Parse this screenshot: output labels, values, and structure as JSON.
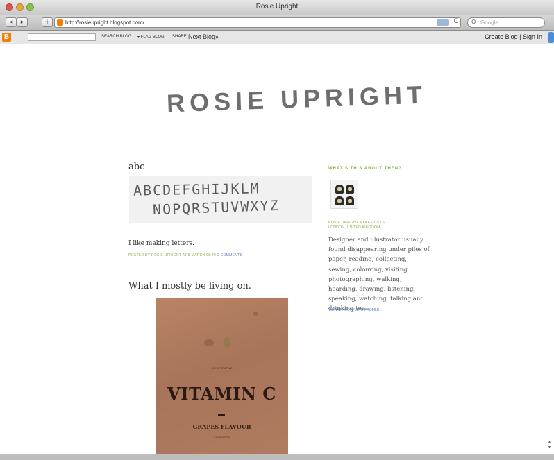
{
  "window": {
    "title": "Rosie Upright"
  },
  "browser": {
    "url": "http://rosieupright.blogspot.com/",
    "search_placeholder": "Google",
    "back_icon": "◂",
    "forward_icon": "▸",
    "add_icon": "+",
    "reload_icon": "C",
    "search_icon": "Q"
  },
  "blogger_bar": {
    "logo": "B",
    "search_label": "SEARCH BLOG",
    "flag_label": "▾ FLAG BLOG",
    "share_label": "SHARE",
    "next_blog": "Next Blog»",
    "create_signin": "Create Blog | Sign In"
  },
  "blog": {
    "header_title": "ROSIE UPRIGHT",
    "posts": [
      {
        "title": "abc",
        "image_text_line1": "ABCDEFGHIJKLM",
        "image_text_line2": "NOPQRSTUVWXYZ",
        "body": "I like making letters.",
        "posted_by": "POSTED BY ROSIE UPRIGHT AT 5 MARCH 08:40",
        "comments": "0 COMMENTS"
      },
      {
        "title": "What I mostly be living on.",
        "image_small_text": "CO-OPERATIVE",
        "image_big_text": "VITAMIN C",
        "image_sub_text": "GRAPES FLAVOUR",
        "image_qty_text": "24 TABLETS"
      }
    ],
    "sidebar": {
      "heading": "WHAT'S THIS ABOUT THEN?",
      "location_line1": "ROSIE UPRIGHT MAKES US LE",
      "location_line2": "LONDON, UNITED KINGDOM",
      "about": "Designer and illustrator usually found disappearing under piles of paper, reading, collecting, sewing, colouring, visiting, photographing, walking, hoarding, drawing, listening, speaking, watching, talking and drinking tea.",
      "profile_link": "VIEW MY COMPLETE PROFILE"
    }
  },
  "colors": {
    "accent_green": "#8ab04a",
    "link_blue": "#5a7fbf",
    "title_gray": "#6e6e6e"
  }
}
